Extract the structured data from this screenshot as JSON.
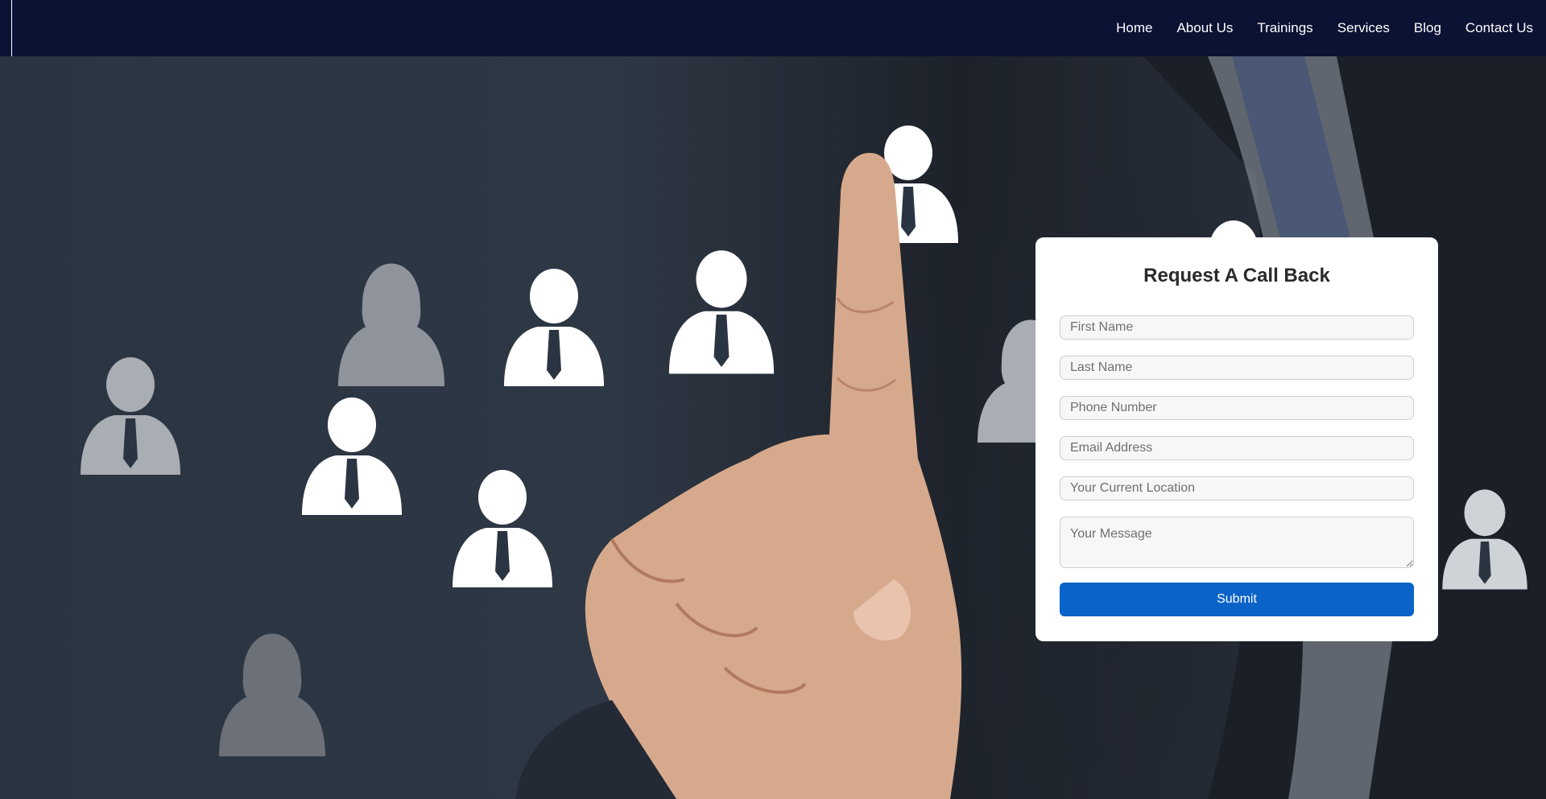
{
  "navbar": {
    "links": [
      {
        "label": "Home"
      },
      {
        "label": "About Us"
      },
      {
        "label": "Trainings"
      },
      {
        "label": "Services"
      },
      {
        "label": "Blog"
      },
      {
        "label": "Contact Us"
      }
    ]
  },
  "form": {
    "title": "Request A Call Back",
    "fields": {
      "first_name": {
        "placeholder": "First Name",
        "value": ""
      },
      "last_name": {
        "placeholder": "Last Name",
        "value": ""
      },
      "phone": {
        "placeholder": "Phone Number",
        "value": ""
      },
      "email": {
        "placeholder": "Email Address",
        "value": ""
      },
      "location": {
        "placeholder": "Your Current Location",
        "value": ""
      },
      "message": {
        "placeholder": "Your Message",
        "value": ""
      }
    },
    "submit_label": "Submit"
  },
  "colors": {
    "navbar_bg": "#0c1233",
    "submit_bg": "#0a63c9",
    "card_bg": "#ffffff"
  },
  "hero": {
    "icons": [
      "person-icon",
      "person-with-tie-icon",
      "woman-icon",
      "pointing-hand-image"
    ]
  }
}
